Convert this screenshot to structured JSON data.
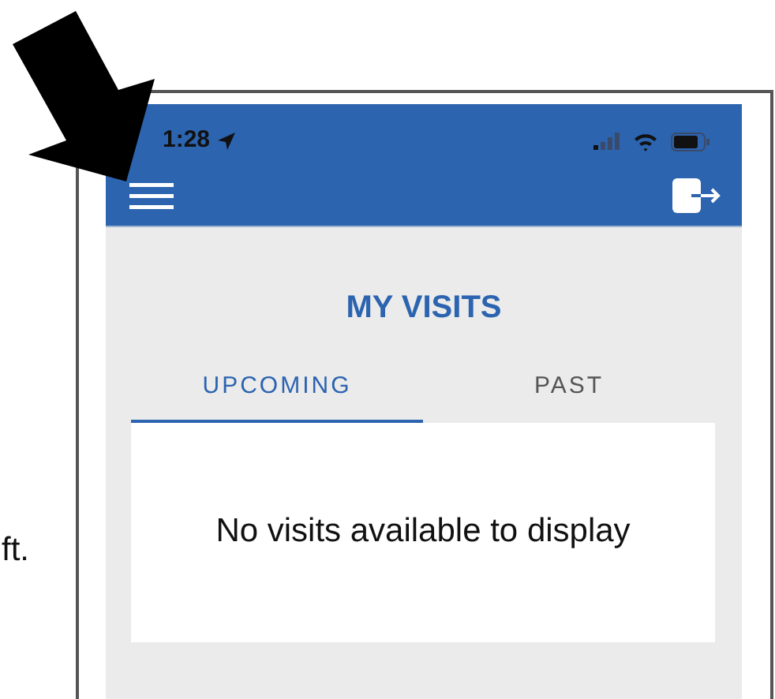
{
  "side_text": "ft.",
  "status_bar": {
    "time": "1:28"
  },
  "title": "MY VISITS",
  "tabs": [
    {
      "label": "UPCOMING",
      "selected": true
    },
    {
      "label": "PAST",
      "selected": false
    }
  ],
  "message": "No visits available to display"
}
